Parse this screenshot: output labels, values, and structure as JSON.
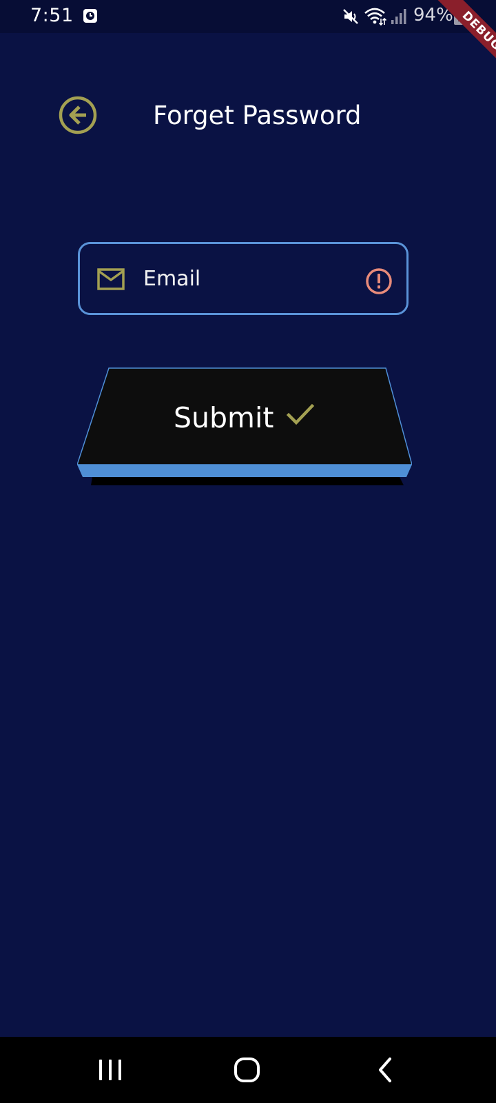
{
  "status_bar": {
    "time": "7:51",
    "battery": "94%",
    "icons": [
      "app-notification-icon",
      "mute-icon",
      "wifi-icon",
      "signal-icon",
      "battery-icon"
    ]
  },
  "debug_banner": "DEBUG",
  "header": {
    "back_icon": "back-arrow-circle-icon",
    "title": "Forget Password"
  },
  "form": {
    "email": {
      "placeholder": "Email",
      "value": "",
      "leading_icon": "mail-icon",
      "trailing_icon": "error-icon"
    },
    "submit": {
      "label": "Submit",
      "icon": "check-icon"
    }
  },
  "navigation": {
    "buttons": [
      "recent-apps",
      "home",
      "back"
    ]
  },
  "colors": {
    "background": "#0a1244",
    "status_bar": "#070d35",
    "accent_olive": "#a3a052",
    "field_border": "#5a93d8",
    "error": "#e88b7a",
    "button_face": "#0d0d0d",
    "button_edge": "#4f8fd6",
    "debug_ribbon": "#8a1f2b"
  }
}
